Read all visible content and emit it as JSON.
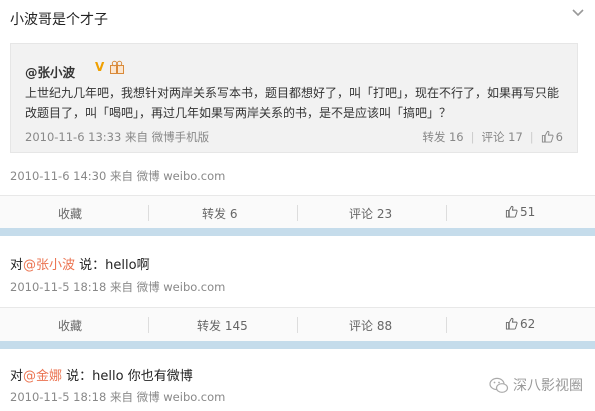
{
  "post": {
    "title": "小波哥是个才子",
    "quote": {
      "author": "@张小波",
      "verified": "V",
      "text": "上世纪九几年吧，我想针对两岸关系写本书，题目都想好了，叫「打吧」，现在不行了，如果再写只能改题目了，叫「喝吧」，再过几年如果写两岸关系的书，是不是应该叫「搞吧」？",
      "time": "2010-11-6 13:33",
      "source": "来自 微博手机版",
      "repost": "转发 16",
      "comment": "评论 17",
      "likes": "6"
    },
    "time": "2010-11-6 14:30",
    "source": "来自 微博 weibo.com",
    "actions": {
      "fav": "收藏",
      "repost": "转发 6",
      "comment": "评论 23",
      "likes": "51"
    }
  },
  "post2": {
    "prefix": "对",
    "mention": "@张小波",
    "suffix": " 说：hello啊",
    "time": "2010-11-5 18:18",
    "source": "来自 微博 weibo.com",
    "actions": {
      "fav": "收藏",
      "repost": "转发 145",
      "comment": "评论 88",
      "likes": "62"
    }
  },
  "post3": {
    "prefix": "对",
    "mention": "@金娜",
    "suffix": " 说：hello 你也有微博",
    "time": "2010-11-5 18:18",
    "source": "来自 微博 weibo.com"
  },
  "watermark": "深八影视圈",
  "colors": {
    "mention": "#eb7350",
    "separator": "#c5dceb"
  }
}
